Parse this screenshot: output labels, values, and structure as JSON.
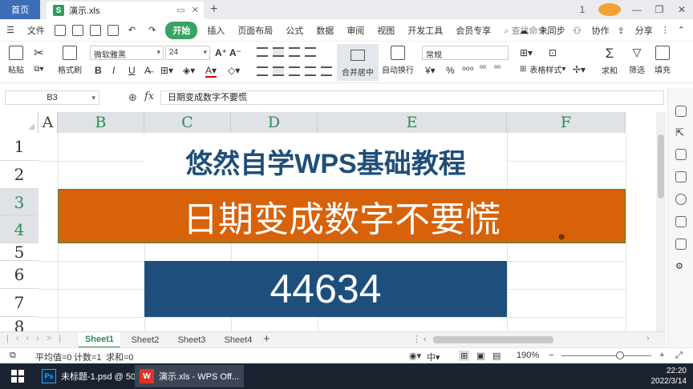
{
  "titlebar": {
    "home_tab": "首页",
    "doc_tab_icon": "S",
    "doc_tab_title": "演示.xls",
    "new_tab": "+",
    "win_badge": "1"
  },
  "menubar": {
    "file": "文件",
    "start": "开始",
    "tabs": [
      "插入",
      "页面布局",
      "公式",
      "数据",
      "审阅",
      "视图",
      "开发工具",
      "会员专享"
    ],
    "search": "查找命令...",
    "unsync": "未同步",
    "collab": "协作",
    "share": "分享"
  },
  "ribbon": {
    "paste": "粘贴",
    "format_painter": "格式刷",
    "font_name": "微软雅黑",
    "font_size": "24",
    "bold": "B",
    "merge_center": "合并居中",
    "wrap_text": "自动换行",
    "number_format": "常规",
    "table_style": "表格样式",
    "sum": "求和",
    "filter": "筛选",
    "fill": "填充"
  },
  "formulabar": {
    "cell_ref": "B3",
    "fx": "fx",
    "content": "日期变成数字不要慌"
  },
  "grid": {
    "columns": [
      "A",
      "B",
      "C",
      "D",
      "E",
      "F"
    ],
    "rows": [
      "1",
      "2",
      "3",
      "4",
      "5",
      "6",
      "7",
      "8"
    ],
    "title_text": "悠然自学WPS基础教程",
    "orange_text": "日期变成数字不要慌",
    "blue_text": "44634"
  },
  "sheets": [
    "Sheet1",
    "Sheet2",
    "Sheet3",
    "Sheet4"
  ],
  "statusbar": {
    "average": "平均值=0",
    "count": "计数=1",
    "sum": "求和=0",
    "zoom": "190%"
  },
  "taskbar": {
    "ps_icon": "Ps",
    "ps_title": "未标题-1.psd @ 50...",
    "wps_icon": "W",
    "wps_title": "演示.xls - WPS Off...",
    "time": "22:20",
    "date": "2022/3/14"
  },
  "colors": {
    "orange_fill": "#d8620a",
    "blue_fill": "#1e4f7c",
    "title_text": "#1f4e79",
    "accent_green": "#2e8b57"
  }
}
